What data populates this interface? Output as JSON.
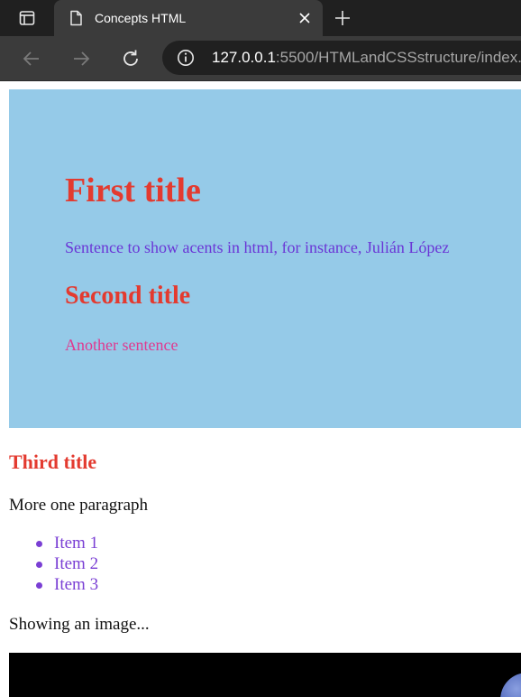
{
  "browser": {
    "tab": {
      "title": "Concepts HTML"
    },
    "address": {
      "host": "127.0.0.1",
      "rest": ":5500/HTMLandCSSstructure/index."
    }
  },
  "page": {
    "hero": {
      "title": "First title",
      "sentence": "Sentence to show acents in html, for instance, Julián López",
      "subtitle": "Second title",
      "another": "Another sentence"
    },
    "third_title": "Third title",
    "paragraph": "More one paragraph",
    "items": [
      "Item 1",
      "Item 2",
      "Item 3"
    ],
    "image_caption": "Showing an image..."
  },
  "colors": {
    "hero_bg": "#95cae8",
    "title_red": "#e33a2f",
    "purple": "#6a36d6",
    "pink": "#e0398f",
    "list_purple": "#7a3fd4"
  }
}
